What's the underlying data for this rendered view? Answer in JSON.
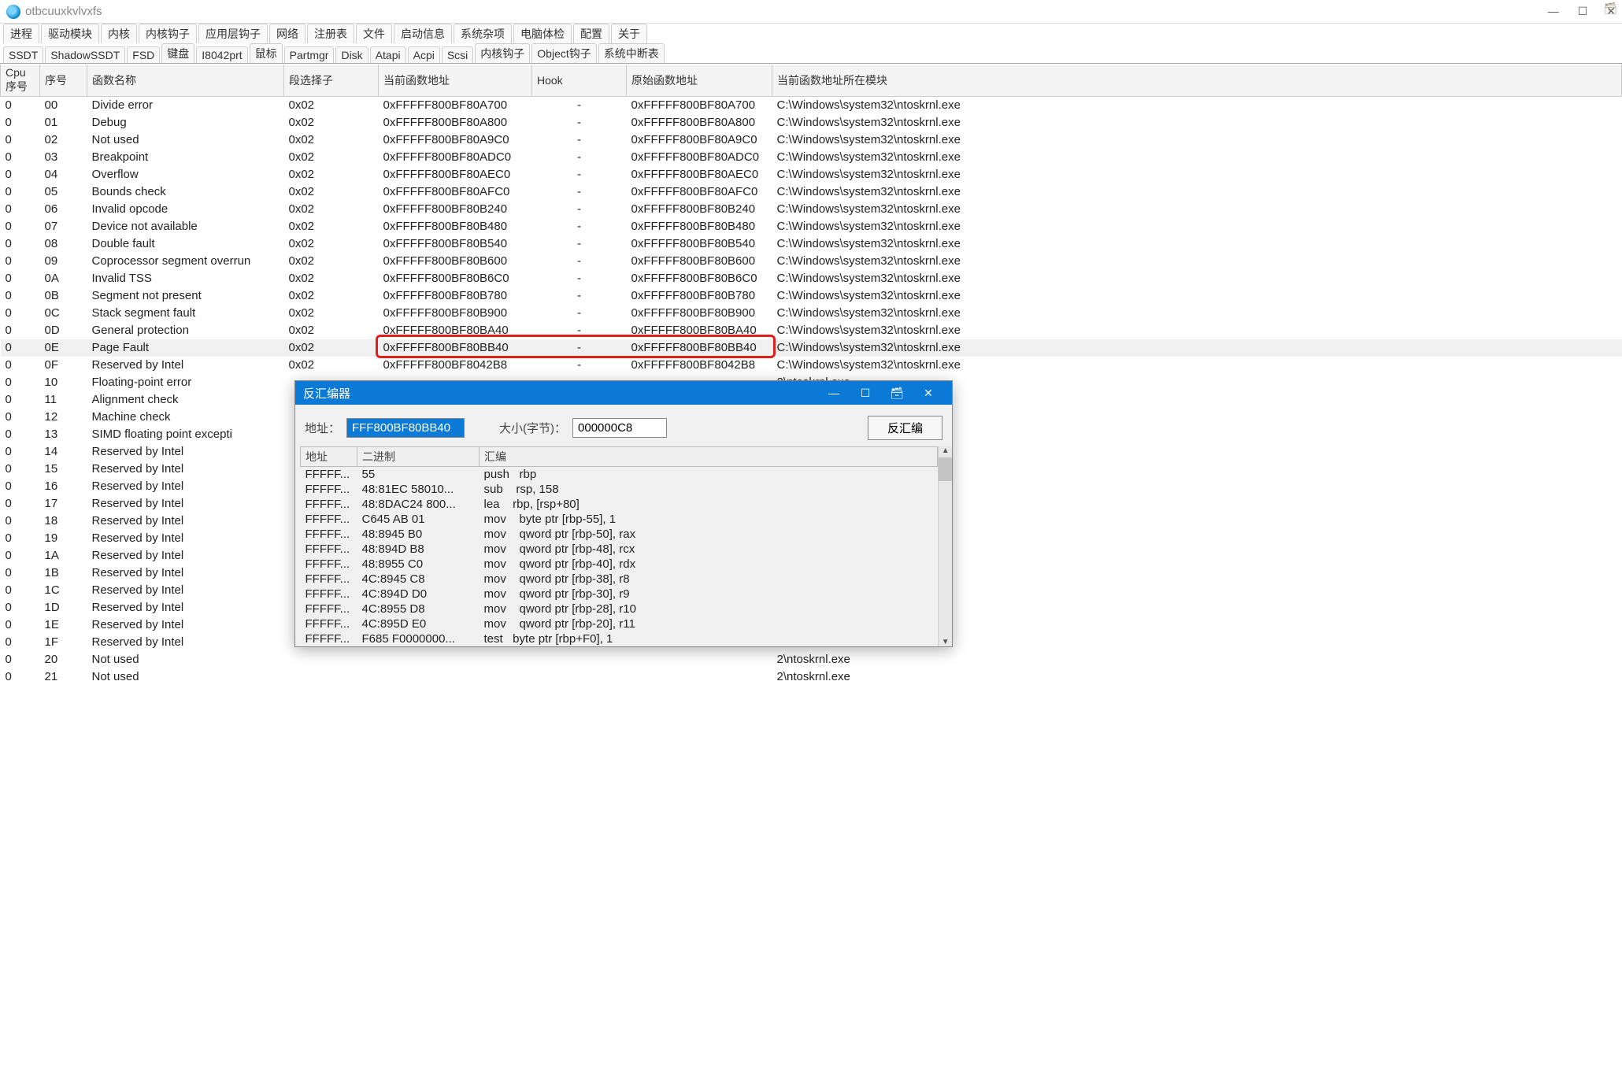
{
  "title": "otbcuuxkvlvxfs",
  "window_buttons": {
    "min": "—",
    "max": "☐",
    "close": "✕"
  },
  "menu": [
    "进程",
    "驱动模块",
    "内核",
    "内核钩子",
    "应用层钩子",
    "网络",
    "注册表",
    "文件",
    "启动信息",
    "系统杂项",
    "电脑体检",
    "配置",
    "关于"
  ],
  "tabs": [
    "SSDT",
    "ShadowSSDT",
    "FSD",
    "键盘",
    "I8042prt",
    "鼠标",
    "Partmgr",
    "Disk",
    "Atapi",
    "Acpi",
    "Scsi",
    "内核钩子",
    "Object钩子",
    "系统中断表"
  ],
  "columns": [
    "Cpu序号",
    "序号",
    "函数名称",
    "段选择子",
    "当前函数地址",
    "Hook",
    "原始函数地址",
    "当前函数地址所在模块"
  ],
  "module_full": "C:\\Windows\\system32\\ntoskrnl.exe",
  "module_clip": "2\\ntoskrnl.exe",
  "rows": [
    {
      "cpu": "0",
      "idx": "00",
      "fn": "Divide error",
      "seg": "0x02",
      "cur": "0xFFFFF800BF80A700",
      "hook": "-",
      "orig": "0xFFFFF800BF80A700",
      "clip": false
    },
    {
      "cpu": "0",
      "idx": "01",
      "fn": "Debug",
      "seg": "0x02",
      "cur": "0xFFFFF800BF80A800",
      "hook": "-",
      "orig": "0xFFFFF800BF80A800",
      "clip": false
    },
    {
      "cpu": "0",
      "idx": "02",
      "fn": "Not used",
      "seg": "0x02",
      "cur": "0xFFFFF800BF80A9C0",
      "hook": "-",
      "orig": "0xFFFFF800BF80A9C0",
      "clip": false
    },
    {
      "cpu": "0",
      "idx": "03",
      "fn": "Breakpoint",
      "seg": "0x02",
      "cur": "0xFFFFF800BF80ADC0",
      "hook": "-",
      "orig": "0xFFFFF800BF80ADC0",
      "clip": false
    },
    {
      "cpu": "0",
      "idx": "04",
      "fn": "Overflow",
      "seg": "0x02",
      "cur": "0xFFFFF800BF80AEC0",
      "hook": "-",
      "orig": "0xFFFFF800BF80AEC0",
      "clip": false
    },
    {
      "cpu": "0",
      "idx": "05",
      "fn": "Bounds check",
      "seg": "0x02",
      "cur": "0xFFFFF800BF80AFC0",
      "hook": "-",
      "orig": "0xFFFFF800BF80AFC0",
      "clip": false
    },
    {
      "cpu": "0",
      "idx": "06",
      "fn": "Invalid opcode",
      "seg": "0x02",
      "cur": "0xFFFFF800BF80B240",
      "hook": "-",
      "orig": "0xFFFFF800BF80B240",
      "clip": false
    },
    {
      "cpu": "0",
      "idx": "07",
      "fn": "Device not available",
      "seg": "0x02",
      "cur": "0xFFFFF800BF80B480",
      "hook": "-",
      "orig": "0xFFFFF800BF80B480",
      "clip": false
    },
    {
      "cpu": "0",
      "idx": "08",
      "fn": "Double fault",
      "seg": "0x02",
      "cur": "0xFFFFF800BF80B540",
      "hook": "-",
      "orig": "0xFFFFF800BF80B540",
      "clip": false
    },
    {
      "cpu": "0",
      "idx": "09",
      "fn": "Coprocessor segment overrun",
      "seg": "0x02",
      "cur": "0xFFFFF800BF80B600",
      "hook": "-",
      "orig": "0xFFFFF800BF80B600",
      "clip": false
    },
    {
      "cpu": "0",
      "idx": "0A",
      "fn": "Invalid TSS",
      "seg": "0x02",
      "cur": "0xFFFFF800BF80B6C0",
      "hook": "-",
      "orig": "0xFFFFF800BF80B6C0",
      "clip": false
    },
    {
      "cpu": "0",
      "idx": "0B",
      "fn": "Segment not present",
      "seg": "0x02",
      "cur": "0xFFFFF800BF80B780",
      "hook": "-",
      "orig": "0xFFFFF800BF80B780",
      "clip": false
    },
    {
      "cpu": "0",
      "idx": "0C",
      "fn": "Stack segment fault",
      "seg": "0x02",
      "cur": "0xFFFFF800BF80B900",
      "hook": "-",
      "orig": "0xFFFFF800BF80B900",
      "clip": false
    },
    {
      "cpu": "0",
      "idx": "0D",
      "fn": "General protection",
      "seg": "0x02",
      "cur": "0xFFFFF800BF80BA40",
      "hook": "-",
      "orig": "0xFFFFF800BF80BA40",
      "clip": false
    },
    {
      "cpu": "0",
      "idx": "0E",
      "fn": "Page Fault",
      "seg": "0x02",
      "cur": "0xFFFFF800BF80BB40",
      "hook": "-",
      "orig": "0xFFFFF800BF80BB40",
      "clip": false,
      "selected": true
    },
    {
      "cpu": "0",
      "idx": "0F",
      "fn": "Reserved by Intel",
      "seg": "0x02",
      "cur": "0xFFFFF800BF8042B8",
      "hook": "-",
      "orig": "0xFFFFF800BF8042B8",
      "clip": false
    },
    {
      "cpu": "0",
      "idx": "10",
      "fn": "Floating-point error",
      "seg": "",
      "cur": "",
      "hook": "",
      "orig": "",
      "clip": true
    },
    {
      "cpu": "0",
      "idx": "11",
      "fn": "Alignment check",
      "seg": "",
      "cur": "",
      "hook": "",
      "orig": "",
      "clip": true
    },
    {
      "cpu": "0",
      "idx": "12",
      "fn": "Machine check",
      "seg": "",
      "cur": "",
      "hook": "",
      "orig": "",
      "clip": true
    },
    {
      "cpu": "0",
      "idx": "13",
      "fn": "SIMD floating point excepti",
      "seg": "",
      "cur": "",
      "hook": "",
      "orig": "",
      "clip": true
    },
    {
      "cpu": "0",
      "idx": "14",
      "fn": "Reserved by Intel",
      "seg": "",
      "cur": "",
      "hook": "",
      "orig": "",
      "clip": true
    },
    {
      "cpu": "0",
      "idx": "15",
      "fn": "Reserved by Intel",
      "seg": "",
      "cur": "",
      "hook": "",
      "orig": "",
      "clip": true
    },
    {
      "cpu": "0",
      "idx": "16",
      "fn": "Reserved by Intel",
      "seg": "",
      "cur": "",
      "hook": "",
      "orig": "",
      "clip": true
    },
    {
      "cpu": "0",
      "idx": "17",
      "fn": "Reserved by Intel",
      "seg": "",
      "cur": "",
      "hook": "",
      "orig": "",
      "clip": true
    },
    {
      "cpu": "0",
      "idx": "18",
      "fn": "Reserved by Intel",
      "seg": "",
      "cur": "",
      "hook": "",
      "orig": "",
      "clip": true
    },
    {
      "cpu": "0",
      "idx": "19",
      "fn": "Reserved by Intel",
      "seg": "",
      "cur": "",
      "hook": "",
      "orig": "",
      "clip": true
    },
    {
      "cpu": "0",
      "idx": "1A",
      "fn": "Reserved by Intel",
      "seg": "",
      "cur": "",
      "hook": "",
      "orig": "",
      "clip": true
    },
    {
      "cpu": "0",
      "idx": "1B",
      "fn": "Reserved by Intel",
      "seg": "",
      "cur": "",
      "hook": "",
      "orig": "",
      "clip": true
    },
    {
      "cpu": "0",
      "idx": "1C",
      "fn": "Reserved by Intel",
      "seg": "",
      "cur": "",
      "hook": "",
      "orig": "",
      "clip": true
    },
    {
      "cpu": "0",
      "idx": "1D",
      "fn": "Reserved by Intel",
      "seg": "",
      "cur": "",
      "hook": "",
      "orig": "",
      "clip": true
    },
    {
      "cpu": "0",
      "idx": "1E",
      "fn": "Reserved by Intel",
      "seg": "",
      "cur": "",
      "hook": "",
      "orig": "",
      "clip": true
    },
    {
      "cpu": "0",
      "idx": "1F",
      "fn": "Reserved by Intel",
      "seg": "",
      "cur": "",
      "hook": "",
      "orig": "",
      "clip": true
    },
    {
      "cpu": "0",
      "idx": "20",
      "fn": "Not used",
      "seg": "",
      "cur": "",
      "hook": "",
      "orig": "",
      "clip": true
    },
    {
      "cpu": "0",
      "idx": "21",
      "fn": "Not used",
      "seg": "",
      "cur": "",
      "hook": "",
      "orig": "",
      "clip": true
    }
  ],
  "dialog": {
    "title": "反汇编器",
    "win_buttons": {
      "min": "—",
      "max": "☐",
      "close": "✕"
    },
    "addr_label": "地址：",
    "addr_value": "FFF800BF80BB40",
    "size_label": "大小(字节)：",
    "size_value": "000000C8",
    "go_button": "反汇编",
    "columns": [
      "地址",
      "二进制",
      "汇编"
    ],
    "rows": [
      {
        "a": "FFFFF...",
        "b": "55",
        "c": "push   rbp"
      },
      {
        "a": "FFFFF...",
        "b": "48:81EC 58010...",
        "c": "sub    rsp, 158"
      },
      {
        "a": "FFFFF...",
        "b": "48:8DAC24 800...",
        "c": "lea    rbp, [rsp+80]"
      },
      {
        "a": "FFFFF...",
        "b": "C645 AB 01",
        "c": "mov    byte ptr [rbp-55], 1"
      },
      {
        "a": "FFFFF...",
        "b": "48:8945 B0",
        "c": "mov    qword ptr [rbp-50], rax"
      },
      {
        "a": "FFFFF...",
        "b": "48:894D B8",
        "c": "mov    qword ptr [rbp-48], rcx"
      },
      {
        "a": "FFFFF...",
        "b": "48:8955 C0",
        "c": "mov    qword ptr [rbp-40], rdx"
      },
      {
        "a": "FFFFF...",
        "b": "4C:8945 C8",
        "c": "mov    qword ptr [rbp-38], r8"
      },
      {
        "a": "FFFFF...",
        "b": "4C:894D D0",
        "c": "mov    qword ptr [rbp-30], r9"
      },
      {
        "a": "FFFFF...",
        "b": "4C:8955 D8",
        "c": "mov    qword ptr [rbp-28], r10"
      },
      {
        "a": "FFFFF...",
        "b": "4C:895D E0",
        "c": "mov    qword ptr [rbp-20], r11"
      },
      {
        "a": "FFFFF...",
        "b": "F685 F0000000...",
        "c": "test   byte ptr [rbp+F0], 1"
      }
    ]
  }
}
